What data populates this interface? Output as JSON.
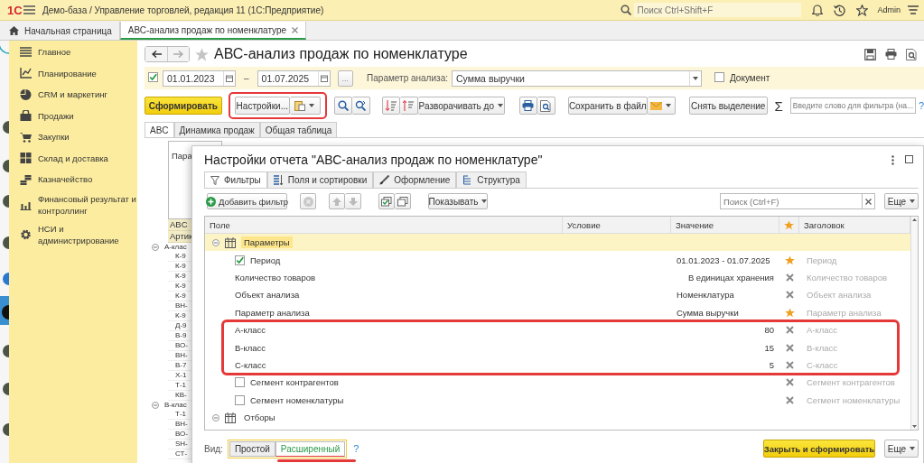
{
  "top_bar": {
    "logo": "1С",
    "title": "Демо-база / Управление торговлей, редакция 11  (1С:Предприятие)",
    "search": {
      "placeholder": "Поиск Ctrl+Shift+F"
    },
    "user": "Admin"
  },
  "open_tabs": [
    {
      "label": "Начальная страница",
      "selected": false
    },
    {
      "label": "АВС-анализ продаж по номенклатуре",
      "selected": true
    }
  ],
  "sidebar": {
    "items": [
      {
        "label": "Главное"
      },
      {
        "label": "Планирование"
      },
      {
        "label": "CRM и маркетинг"
      },
      {
        "label": "Продажи"
      },
      {
        "label": "Закупки"
      },
      {
        "label": "Склад и доставка"
      },
      {
        "label": "Казначейство"
      },
      {
        "label": "Финансовый результат и контроллинг"
      },
      {
        "label": "НСИ и администрирование"
      }
    ]
  },
  "report": {
    "title": "АВС-анализ продаж по номенклатуре",
    "period_enabled": true,
    "date_from": "01.01.2023",
    "separator": "–",
    "date_to": "01.07.2025",
    "more_button": "...",
    "analysis_param": {
      "label": "Параметр анализа:",
      "value": "Сумма выручки"
    },
    "document": {
      "label": "Документ",
      "checked": false
    },
    "toolbar": {
      "generate": "Сформировать",
      "settings": {
        "label": "Настройки...",
        "highlighted": true
      },
      "expand": "Разворачивать до",
      "save": "Сохранить в файл",
      "clear_selection": "Снять выделение",
      "sum": "Σ",
      "filter": {
        "placeholder": "Введите слово для фильтра (на..."
      },
      "help": "?"
    },
    "tabs": [
      {
        "label": "ABC",
        "selected": true
      },
      {
        "label": "Динамика продаж",
        "selected": false
      },
      {
        "label": "Общая таблица",
        "selected": false
      }
    ],
    "sheet": {
      "header": "Пара",
      "column_labels": [
        "ABC",
        "Артик"
      ],
      "groups": [
        {
          "label": "А-клас",
          "rows": [
            "К-9",
            "К-9",
            "К-9",
            "К-9",
            "К-9",
            "ВН-",
            "К-9",
            "Д-9",
            "В-9",
            "ВО-",
            "ВН-",
            "В-7",
            "Х-1",
            "Т-1",
            "КВ-"
          ]
        },
        {
          "label": "В-клас",
          "rows": [
            "Т-1",
            "ВН-",
            "ВО-",
            "SH-",
            "СТ-"
          ]
        }
      ]
    }
  },
  "settings_dialog": {
    "title": "Настройки отчета \"АВС-анализ продаж по номенклатуре\"",
    "tabs": [
      {
        "label": "Фильтры",
        "selected": true
      },
      {
        "label": "Поля и сортировки",
        "selected": false
      },
      {
        "label": "Оформление",
        "selected": false
      },
      {
        "label": "Структура",
        "selected": false
      }
    ],
    "toolbar": {
      "add_filter": "Добавить фильтр",
      "show": "Показывать",
      "search": {
        "placeholder": "Поиск (Ctrl+F)"
      },
      "more": "Еще"
    },
    "columns": [
      "Поле",
      "Условие",
      "Значение",
      "Заголовок"
    ],
    "rows": [
      {
        "kind": "group",
        "field": "Параметры",
        "expanded": true,
        "selected": true,
        "children": [
          {
            "kind": "check",
            "field": "Период",
            "checked": true,
            "value": "01.01.2023 - 01.07.2025",
            "right_aligned": false,
            "quick": true,
            "title": "Период",
            "selected": false,
            "highlighted": false
          },
          {
            "kind": "param",
            "field": "Количество товаров",
            "value": "В единицах хранения",
            "right_aligned": true,
            "quick": false,
            "title": "Количество товаров",
            "selected": false,
            "highlighted": false
          },
          {
            "kind": "param",
            "field": "Объект анализа",
            "value": "Номенклатура",
            "right_aligned": false,
            "quick": false,
            "title": "Объект анализа",
            "selected": false,
            "highlighted": false
          },
          {
            "kind": "param",
            "field": "Параметр анализа",
            "value": "Сумма выручки",
            "right_aligned": false,
            "quick": true,
            "title": "Параметр анализа",
            "selected": false,
            "highlighted": false
          },
          {
            "kind": "param",
            "field": "А-класс",
            "value": "80",
            "right_aligned": true,
            "quick": false,
            "title": "А-класс",
            "selected": false,
            "highlighted": true
          },
          {
            "kind": "param",
            "field": "В-класс",
            "value": "15",
            "right_aligned": true,
            "quick": false,
            "title": "В-класс",
            "selected": false,
            "highlighted": true
          },
          {
            "kind": "param",
            "field": "С-класс",
            "value": "5",
            "right_aligned": true,
            "quick": false,
            "title": "С-класс",
            "selected": false,
            "highlighted": true
          },
          {
            "kind": "check",
            "field": "Сегмент контрагентов",
            "checked": false,
            "quick": false,
            "title": "Сегмент контрагентов",
            "selected": false,
            "highlighted": false
          },
          {
            "kind": "check",
            "field": "Сегмент номенклатуры",
            "checked": false,
            "quick": false,
            "title": "Сегмент номенклатуры",
            "selected": false,
            "highlighted": false
          }
        ]
      },
      {
        "kind": "group",
        "field": "Отборы",
        "expanded": true,
        "selected": false,
        "children": []
      }
    ],
    "footer": {
      "view_label": "Вид:",
      "views": [
        {
          "label": "Простой",
          "selected": false,
          "underlined": false
        },
        {
          "label": "Расширенный",
          "selected": true,
          "underlined": true
        }
      ],
      "help": "?",
      "primary": "Закрыть и сформировать",
      "more": "Еще"
    }
  }
}
